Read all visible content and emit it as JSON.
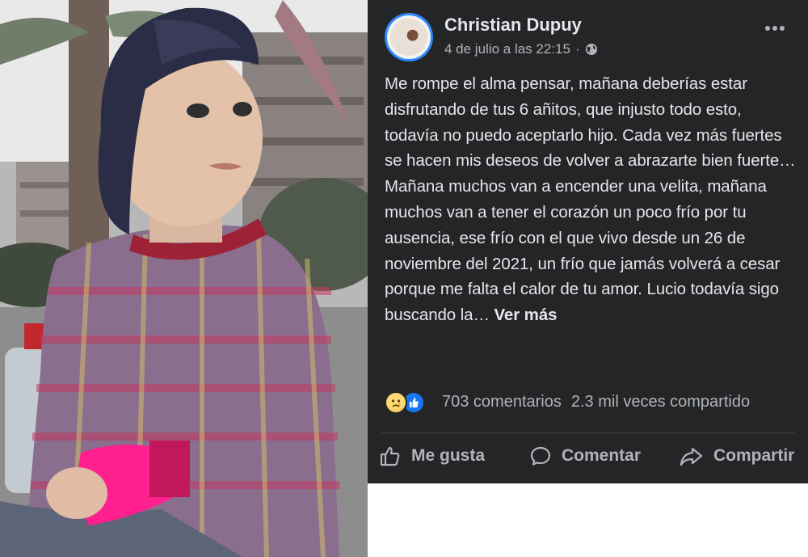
{
  "post": {
    "author": "Christian Dupuy",
    "timestamp": "4 de julio a las 22:15",
    "separator": "·",
    "privacy_icon": "globe-icon",
    "more_icon": "more-options-icon",
    "body": "Me rompe el alma pensar, mañana deberías estar disfrutando de tus 6 añitos, que injusto todo esto, todavía no puedo aceptarlo hijo. Cada vez más fuertes se hacen mis deseos de volver a abrazarte bien fuerte… Mañana muchos van a encender una velita, mañana muchos van a tener el corazón un poco frío por tu ausencia, ese frío con el que vivo desde un 26 de noviembre del 2021, un frío que jamás volverá a cesar porque me falta el calor de tu amor. Lucio todavía sigo buscando la…",
    "see_more": "Ver más"
  },
  "stats": {
    "reaction_icons": [
      "sad-reaction-icon",
      "like-reaction-icon"
    ],
    "comments": "703 comentarios",
    "shares": "2.3 mil veces compartido"
  },
  "actions": {
    "like": "Me gusta",
    "comment": "Comentar",
    "share": "Compartir"
  },
  "colors": {
    "panel_bg": "#242526",
    "text": "#e4e6eb",
    "muted": "#b0b3b8",
    "accent": "#1877f2"
  }
}
